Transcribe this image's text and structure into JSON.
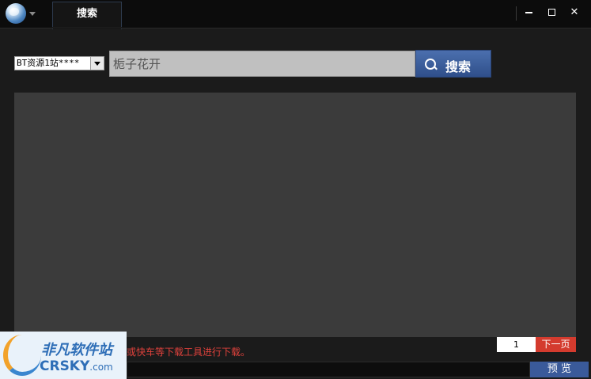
{
  "titlebar": {
    "tab_label": "搜索"
  },
  "search": {
    "source_selected": "BT资源1站****",
    "query": "栀子花开",
    "button_label": "搜索"
  },
  "status": {
    "info_text": "或快车等下载工具进行下载。"
  },
  "pagination": {
    "page": "1",
    "next_label": "下一页"
  },
  "footer": {
    "preview_label": "预 览"
  },
  "watermark": {
    "cn": "非凡软件站",
    "en": "CRSKY",
    "en_suffix": ".com"
  }
}
